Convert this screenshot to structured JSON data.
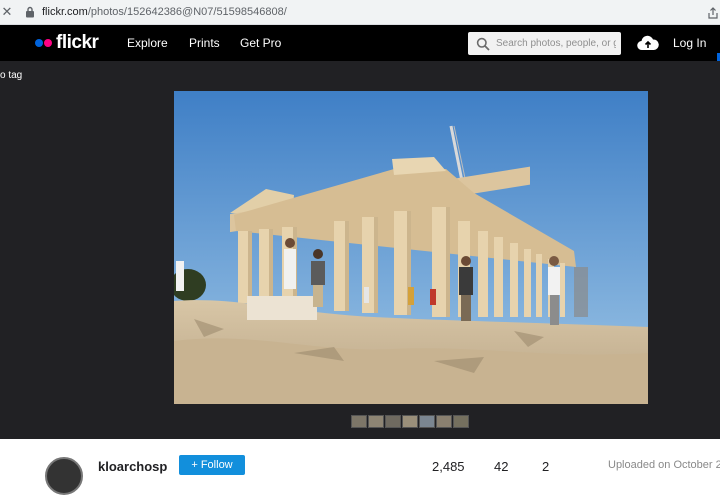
{
  "browser": {
    "url_host": "flickr.com",
    "url_path": "/photos/152642386@N07/51598546808/"
  },
  "nav": {
    "logo": "flickr",
    "links": [
      "Explore",
      "Prints",
      "Get Pro"
    ],
    "search_placeholder": "Search photos, people, or groups",
    "login": "Log In"
  },
  "photo_view": {
    "add_tag": "o tag",
    "filmstrip_count": 7
  },
  "owner": {
    "name": "kloarchosp",
    "follow_label": "+ Follow"
  },
  "stats": {
    "views": "2,485",
    "faves": "42",
    "comments": "2"
  },
  "uploaded_text": "Uploaded on October 2",
  "colors": {
    "nav_bg": "#000000",
    "stage_bg": "#212124",
    "flickr_blue": "#0063dc",
    "flickr_pink": "#ff0084",
    "follow_blue": "#128fdc"
  }
}
